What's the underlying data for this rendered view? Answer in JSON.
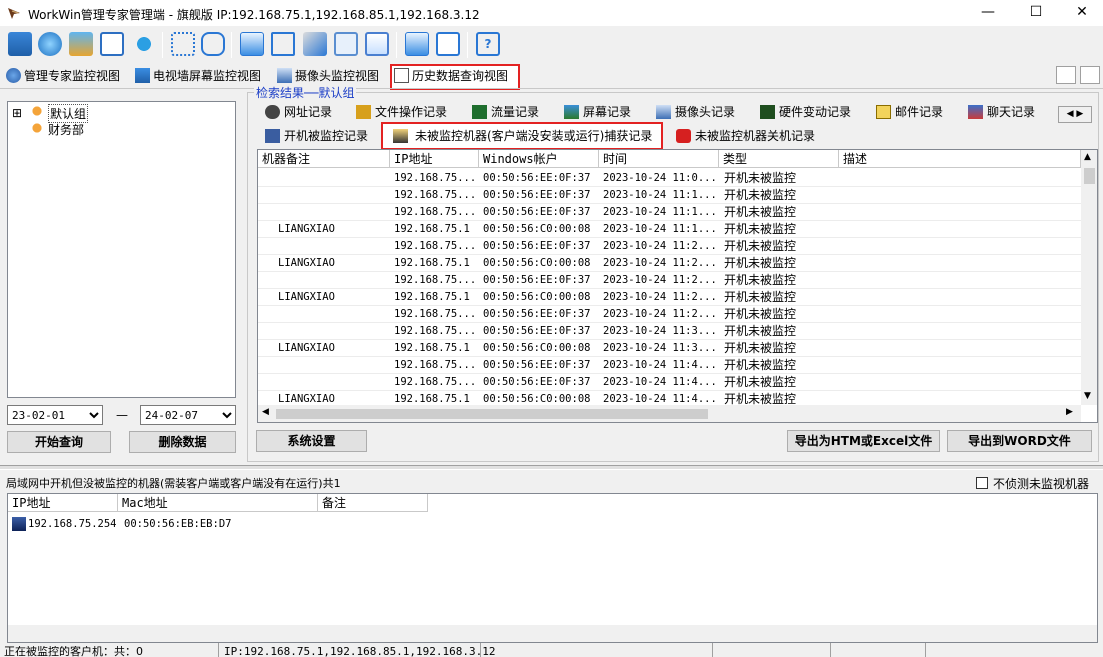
{
  "window": {
    "title": "WorkWin管理专家管理端 - 旗舰版 IP:192.168.75.1,192.168.85.1,192.168.3.12",
    "minimize": "—",
    "maximize": "☐",
    "close": "✕"
  },
  "toolbar_icons": [
    "monitor-view-icon",
    "globe-icon",
    "settings-gear-icon",
    "file-chart-icon",
    "network-icon",
    "apps-grid-icon",
    "lock-icon",
    "screen-share-icon",
    "cast-icon",
    "search-doc-icon",
    "windows-icon",
    "chart-screen-icon",
    "remote-desktop-icon",
    "log-file-icon",
    "help-icon"
  ],
  "main_tabs": [
    {
      "label": "管理专家监控视图"
    },
    {
      "label": "电视墙屏幕监控视图"
    },
    {
      "label": "摄像头监控视图"
    },
    {
      "label": "历史数据查询视图"
    }
  ],
  "tree": {
    "groups": [
      "默认组",
      "财务部"
    ]
  },
  "query": {
    "start_date": "23-02-01",
    "end_date": "24-02-07",
    "separator": "—",
    "search_button": "开始查询",
    "delete_button": "删除数据"
  },
  "results": {
    "group_label": "检索结果──默认组",
    "record_tabs_row1": [
      "网址记录",
      "文件操作记录",
      "流量记录",
      "屏幕记录",
      "摄像头记录",
      "硬件变动记录",
      "邮件记录",
      "聊天记录"
    ],
    "record_tabs_row2": [
      "开机被监控记录",
      "未被监控机器(客户端没安装或运行)捕获记录",
      "未被监控机器关机记录"
    ],
    "columns": [
      "机器备注",
      "IP地址",
      "Windows帐户",
      "时间",
      "类型",
      "描述"
    ],
    "rows": [
      [
        "",
        "192.168.75...",
        "00:50:56:EE:0F:37",
        "2023-10-24 11:0...",
        "开机未被监控",
        ""
      ],
      [
        "",
        "192.168.75...",
        "00:50:56:EE:0F:37",
        "2023-10-24 11:1...",
        "开机未被监控",
        ""
      ],
      [
        "",
        "192.168.75...",
        "00:50:56:EE:0F:37",
        "2023-10-24 11:1...",
        "开机未被监控",
        ""
      ],
      [
        "LIANGXIAO",
        "192.168.75.1",
        "00:50:56:C0:00:08",
        "2023-10-24 11:1...",
        "开机未被监控",
        ""
      ],
      [
        "",
        "192.168.75...",
        "00:50:56:EE:0F:37",
        "2023-10-24 11:2...",
        "开机未被监控",
        ""
      ],
      [
        "LIANGXIAO",
        "192.168.75.1",
        "00:50:56:C0:00:08",
        "2023-10-24 11:2...",
        "开机未被监控",
        ""
      ],
      [
        "",
        "192.168.75...",
        "00:50:56:EE:0F:37",
        "2023-10-24 11:2...",
        "开机未被监控",
        ""
      ],
      [
        "LIANGXIAO",
        "192.168.75.1",
        "00:50:56:C0:00:08",
        "2023-10-24 11:2...",
        "开机未被监控",
        ""
      ],
      [
        "",
        "192.168.75...",
        "00:50:56:EE:0F:37",
        "2023-10-24 11:2...",
        "开机未被监控",
        ""
      ],
      [
        "",
        "192.168.75...",
        "00:50:56:EE:0F:37",
        "2023-10-24 11:3...",
        "开机未被监控",
        ""
      ],
      [
        "LIANGXIAO",
        "192.168.75.1",
        "00:50:56:C0:00:08",
        "2023-10-24 11:3...",
        "开机未被监控",
        ""
      ],
      [
        "",
        "192.168.75...",
        "00:50:56:EE:0F:37",
        "2023-10-24 11:4...",
        "开机未被监控",
        ""
      ],
      [
        "",
        "192.168.75...",
        "00:50:56:EE:0F:37",
        "2023-10-24 11:4...",
        "开机未被监控",
        ""
      ],
      [
        "LIANGXIAO",
        "192.168.75.1",
        "00:50:56:C0:00:08",
        "2023-10-24 11:4...",
        "开机未被监控",
        ""
      ]
    ],
    "settings_button": "系统设置",
    "export_html_button": "导出为HTM或Excel文件",
    "export_word_button": "导出到WORD文件"
  },
  "unmonitored": {
    "title": "局域网中开机但没被监控的机器(需装客户端或客户端没有在运行)共1",
    "checkbox_label": "不侦测未监视机器",
    "columns": [
      "IP地址",
      "Mac地址",
      "备注"
    ],
    "rows": [
      [
        "192.168.75.254",
        "00:50:56:EB:EB:D7",
        ""
      ]
    ]
  },
  "status": {
    "clients": "正在被监控的客户机：共：0",
    "ip": "IP:192.168.75.1,192.168.85.1,192.168.3.12"
  }
}
